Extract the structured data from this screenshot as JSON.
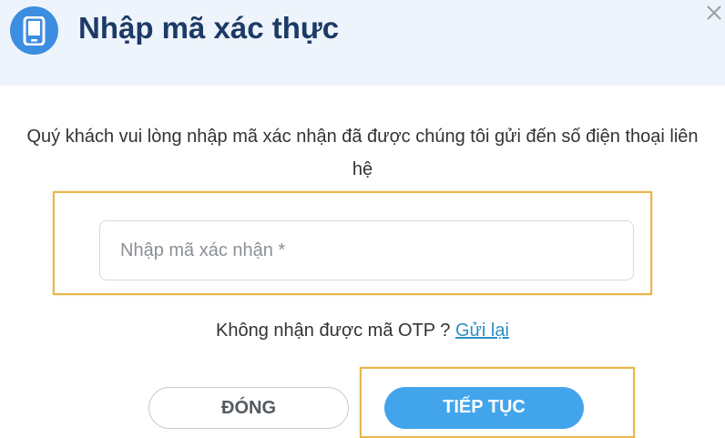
{
  "header": {
    "title": "Nhập mã xác thực",
    "icon": "phone-icon",
    "close_icon": "close-icon"
  },
  "message": "Quý khách vui lòng nhập mã xác nhận đã được chúng tôi gửi đến số điện thoại liên hệ",
  "otp_input": {
    "placeholder": "Nhập mã xác nhận *",
    "value": ""
  },
  "resend": {
    "text": "Không nhận được mã OTP ? ",
    "link_label": "Gửi lại"
  },
  "buttons": {
    "close_label": "ĐÓNG",
    "continue_label": "TIẾP TỤC"
  },
  "colors": {
    "header_bg": "#eef4fb",
    "title": "#1c3a66",
    "accent": "#42a5ec",
    "icon_bg": "#3d8de0",
    "link": "#2b8fc6",
    "highlight": "#e8b64c"
  }
}
